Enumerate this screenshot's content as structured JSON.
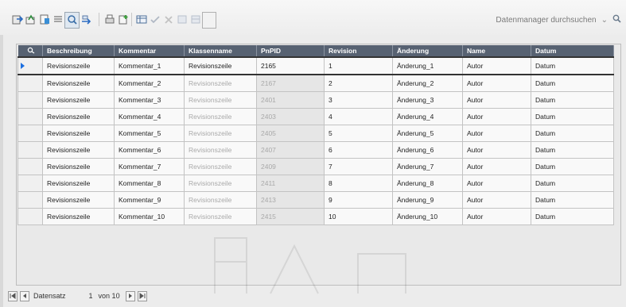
{
  "toolbar": {
    "icons": [
      "import-icon",
      "export-icon",
      "properties-icon",
      "list-icon",
      "find-icon",
      "update-icon",
      "print-icon",
      "new-icon",
      "check-icon",
      "cross-icon",
      "filter-icon",
      "table-icon",
      "frame-icon"
    ],
    "search_placeholder": "Datenmanager durchsuchen",
    "chevron_glyph": "⌄",
    "search_glyph": "🔍"
  },
  "grid": {
    "columns": [
      "Beschreibung",
      "Kommentar",
      "Klassenname",
      "PnPID",
      "Revision",
      "Änderung",
      "Name",
      "Datum"
    ],
    "rows": [
      [
        "Revisionszeile",
        "Kommentar_1",
        "Revisionszeile",
        "2165",
        "1",
        "Änderung_1",
        "Autor",
        "Datum"
      ],
      [
        "Revisionszeile",
        "Kommentar_2",
        "Revisionszeile",
        "2167",
        "2",
        "Änderung_2",
        "Autor",
        "Datum"
      ],
      [
        "Revisionszeile",
        "Kommentar_3",
        "Revisionszeile",
        "2401",
        "3",
        "Änderung_3",
        "Autor",
        "Datum"
      ],
      [
        "Revisionszeile",
        "Kommentar_4",
        "Revisionszeile",
        "2403",
        "4",
        "Änderung_4",
        "Autor",
        "Datum"
      ],
      [
        "Revisionszeile",
        "Kommentar_5",
        "Revisionszeile",
        "2405",
        "5",
        "Änderung_5",
        "Autor",
        "Datum"
      ],
      [
        "Revisionszeile",
        "Kommentar_6",
        "Revisionszeile",
        "2407",
        "6",
        "Änderung_6",
        "Autor",
        "Datum"
      ],
      [
        "Revisionszeile",
        "Kommentar_7",
        "Revisionszeile",
        "2409",
        "7",
        "Änderung_7",
        "Autor",
        "Datum"
      ],
      [
        "Revisionszeile",
        "Kommentar_8",
        "Revisionszeile",
        "2411",
        "8",
        "Änderung_8",
        "Autor",
        "Datum"
      ],
      [
        "Revisionszeile",
        "Kommentar_9",
        "Revisionszeile",
        "2413",
        "9",
        "Änderung_9",
        "Autor",
        "Datum"
      ],
      [
        "Revisionszeile",
        "Kommentar_10",
        "Revisionszeile",
        "2415",
        "10",
        "Änderung_10",
        "Autor",
        "Datum"
      ]
    ]
  },
  "navigator": {
    "label": "Datensatz",
    "current": "1",
    "of_text": "von 10"
  }
}
